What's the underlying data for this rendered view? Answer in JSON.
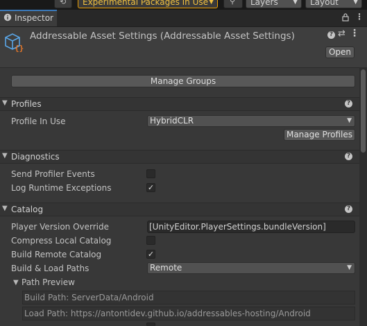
{
  "toolbar": {
    "experimental_packages": "Experimental Packages In Use",
    "layers": "Layers",
    "layout": "Layout"
  },
  "tab": {
    "label": "Inspector"
  },
  "header": {
    "title": "Addressable Asset Settings (Addressable Asset Settings)",
    "open_label": "Open"
  },
  "manage_groups_label": "Manage Groups",
  "profiles": {
    "section_label": "Profiles",
    "profile_in_use_label": "Profile In Use",
    "profile_in_use_value": "HybridCLR",
    "manage_profiles_label": "Manage Profiles"
  },
  "diagnostics": {
    "section_label": "Diagnostics",
    "send_profiler_events_label": "Send Profiler Events",
    "send_profiler_events_checked": false,
    "log_runtime_exceptions_label": "Log Runtime Exceptions",
    "log_runtime_exceptions_checked": true
  },
  "catalog": {
    "section_label": "Catalog",
    "player_version_override_label": "Player Version Override",
    "player_version_override_value": "[UnityEditor.PlayerSettings.bundleVersion]",
    "compress_local_catalog_label": "Compress Local Catalog",
    "compress_local_catalog_checked": false,
    "build_remote_catalog_label": "Build Remote Catalog",
    "build_remote_catalog_checked": true,
    "build_load_paths_label": "Build & Load Paths",
    "build_load_paths_value": "Remote",
    "path_preview_label": "Path Preview",
    "build_path": "Build Path: ServerData/Android",
    "load_path": "Load Path: https://antontidev.github.io/addressables-hosting/Android"
  },
  "colors": {
    "accent_tab": "#3a79bb",
    "warning": "#f0a000",
    "icon_blue": "#5aa6e6",
    "icon_orange": "#e8782a"
  }
}
